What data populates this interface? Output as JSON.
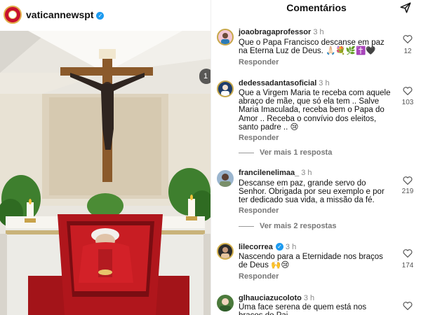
{
  "post": {
    "username": "vaticannewspt",
    "carousel_badge": "1",
    "colors": {
      "verified": "#1d9bf0"
    }
  },
  "comments_header": {
    "title": "Comentários",
    "send_icon": "paper-plane-icon"
  },
  "comments": [
    {
      "user": "joaobragaprofessor",
      "ago": "3 h",
      "text": "Que o Papa Francisco descanse em paz na Eterna Luz de Deus. 🙏🏻💐🌿✝️🖤",
      "reply_label": "Responder",
      "likes": "12"
    },
    {
      "user": "dedessadantasoficial",
      "ago": "3 h",
      "text": "Que a Virgem Maria te receba com aquele abraço de mãe, que só ela tem .. Salve Maria Imaculada, receba bem o Papa do Amor .. Receba o convívio dos eleitos, santo padre .. 😢",
      "reply_label": "Responder",
      "likes": "103",
      "more_replies": "Ver mais 1 resposta"
    },
    {
      "user": "francilenelimaa_",
      "ago": "3 h",
      "text": "Descanse em paz, grande servo do Senhor. Obrigada por seu exemplo e por ter dedicado sua vida, a missão da fé.",
      "reply_label": "Responder",
      "likes": "219",
      "more_replies": "Ver mais 2 respostas"
    },
    {
      "user": "lilecorrea",
      "ago": "3 h",
      "text": "Nascendo para a Eternidade nos braços de Deus 🙌😢",
      "reply_label": "Responder",
      "likes": "174"
    },
    {
      "user": "glhauciazucoloto",
      "ago": "3 h",
      "text": "Uma face serena de quem está nos braços do Pai",
      "likes": ""
    }
  ]
}
